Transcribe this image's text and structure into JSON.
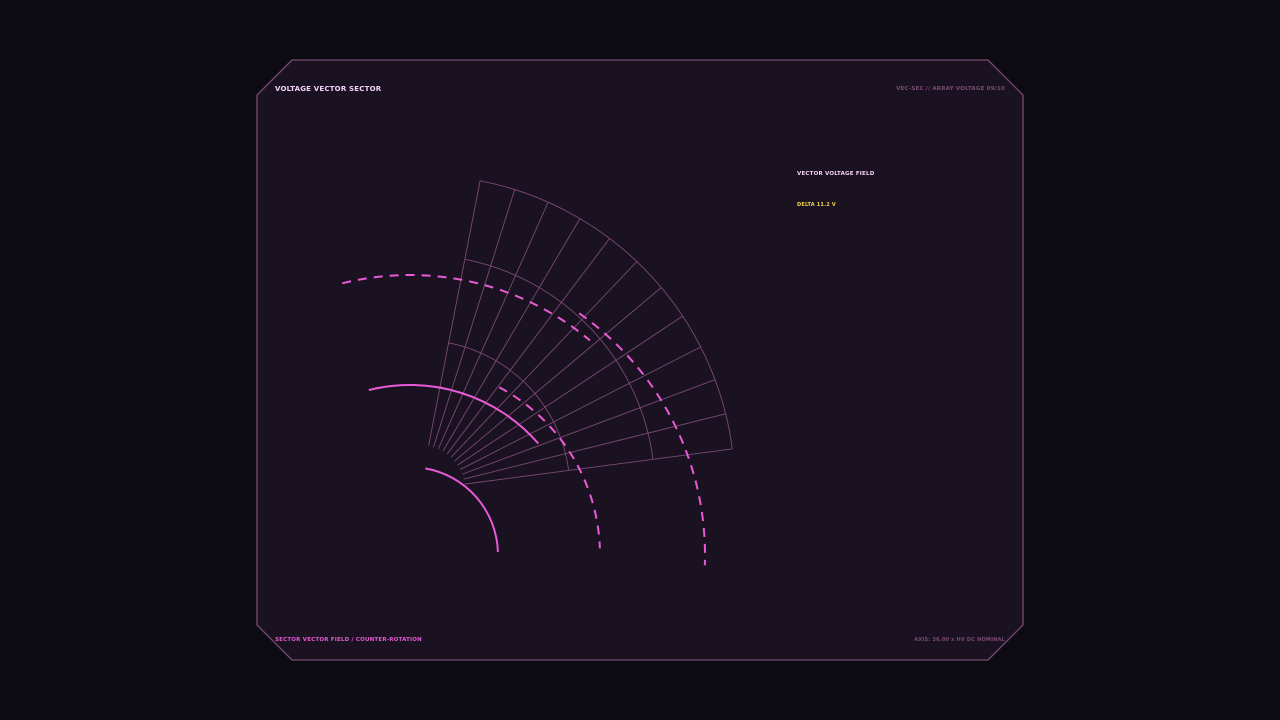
{
  "header": {
    "title": "VOLTAGE VECTOR SECTOR",
    "code": "VEC-SEC // ARRAY VOLTAGE 09/10"
  },
  "legend": {
    "label": "VECTOR VOLTAGE FIELD",
    "delta": "DELTA 11.2 V"
  },
  "footer": {
    "left": "SECTOR VECTOR FIELD / COUNTER-ROTATION",
    "right": "AXIS: 36.00 x HV DC NOMINAL"
  },
  "colors": {
    "background": "#0c0a12",
    "panel": "#1a1221",
    "panel_border": "#7a4a72",
    "grid": "#7a4a72",
    "accent": "#e85ad6",
    "title_text": "#f4d2f6",
    "delta_text": "#f1d548"
  }
}
